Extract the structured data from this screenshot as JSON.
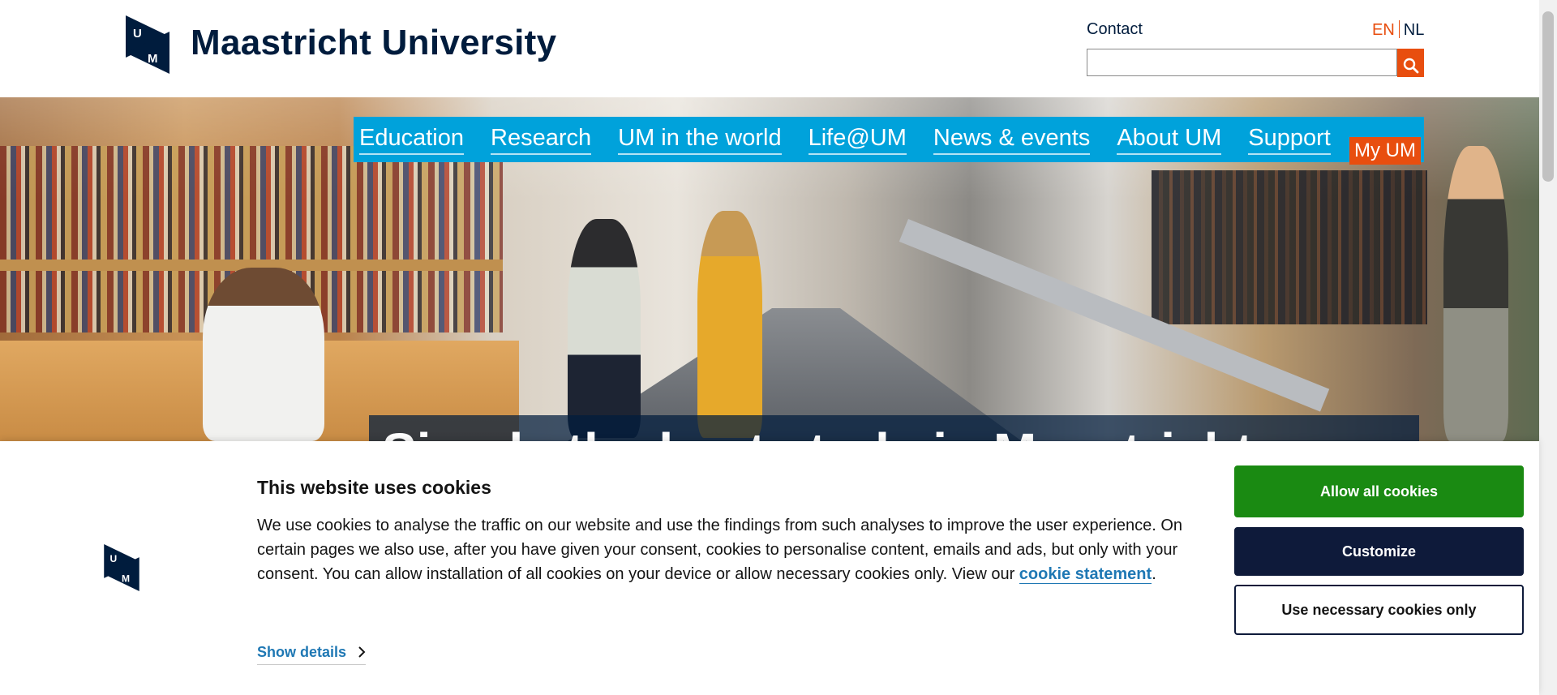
{
  "header": {
    "brand": "Maastricht University",
    "contact_label": "Contact",
    "lang_en": "EN",
    "lang_nl": "NL",
    "search_placeholder": "",
    "accent_color": "#e84e0f",
    "brand_color": "#001c3d"
  },
  "nav": {
    "items": [
      {
        "label": "Education"
      },
      {
        "label": "Research"
      },
      {
        "label": "UM in the world"
      },
      {
        "label": "Life@UM"
      },
      {
        "label": "News & events"
      },
      {
        "label": "About UM"
      },
      {
        "label": "Support"
      }
    ],
    "my_um": "My UM",
    "nav_color": "#00a2db"
  },
  "hero": {
    "title": "Simply the best study in Maastricht"
  },
  "cookie": {
    "title": "This website uses cookies",
    "text_before_link": "We use cookies to analyse the traffic on our website and use the findings from such analyses to improve the user experience. On certain pages we also use, after you have given your consent, cookies to personalise content, emails and ads, but only with your consent. You can allow installation of all cookies on your device or allow necessary cookies only. View our ",
    "link_label": "cookie statement",
    "text_after_link": ".",
    "show_details": "Show details",
    "allow_all": "Allow all cookies",
    "customize": "Customize",
    "necessary_only": "Use necessary cookies only",
    "allow_color": "#1a8a12",
    "customize_color": "#0e1a3a"
  },
  "icons": {
    "logo": "um-logo-icon",
    "search": "search-icon",
    "chevron": "chevron-right-icon"
  }
}
